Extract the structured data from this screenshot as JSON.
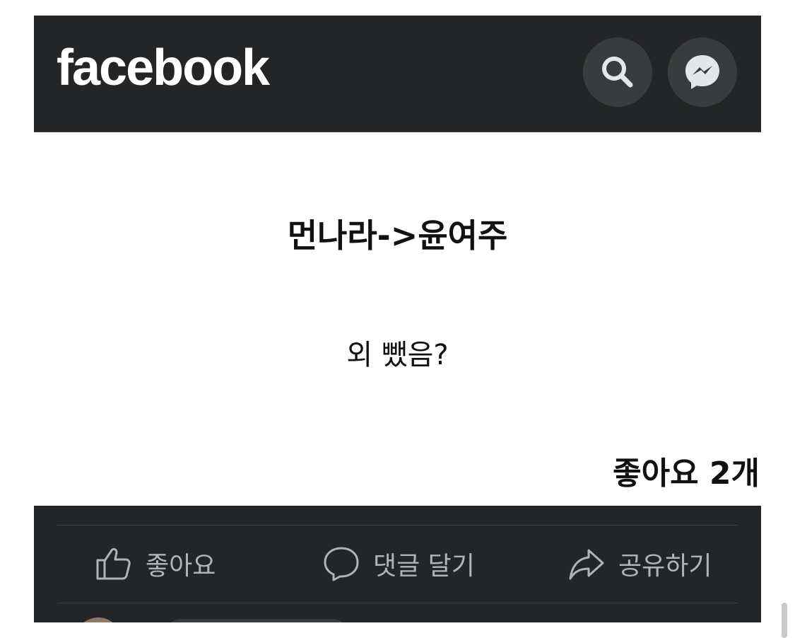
{
  "header": {
    "logo_text": "facebook",
    "search_icon": "search-icon",
    "messenger_icon": "messenger-icon"
  },
  "post": {
    "title": "먼나라->윤여주",
    "body": "외 뺐음?",
    "likes_count": "좋아요 2개"
  },
  "actions": {
    "like_label": "좋아요",
    "comment_label": "댓글 달기",
    "share_label": "공유하기"
  },
  "colors": {
    "bar_background": "#242526",
    "button_background": "#3a3b3c",
    "action_text": "#b0b3b8"
  }
}
